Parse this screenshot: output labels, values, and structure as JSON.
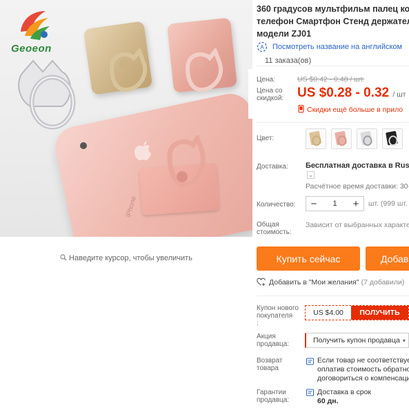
{
  "colors": {
    "accent": "#e62e04",
    "button": "#fb7a1a",
    "link": "#2a64c5"
  },
  "brand": {
    "logo_text": "Geoeon"
  },
  "gallery": {
    "phone_text": "iPhone",
    "zoom_hint": "Наведите курсор, чтобы увеличить"
  },
  "product": {
    "title_lines": [
      "360 градусов мультфильм палец коль",
      "телефон Смартфон Стенд держатель",
      "модели ZJ01"
    ],
    "translate_link": "Посмотреть название на английском",
    "orders": "11 заказа(ов)"
  },
  "price": {
    "label": "Цена:",
    "old": "US $0.42 - 0.48 / шт.",
    "discount_label_1": "Цена со",
    "discount_label_2": "скидкой:",
    "new": "US $0.28 - 0.32",
    "unit": "/ шт",
    "discount_note": "Скидки ещё больше в прило"
  },
  "options": {
    "color_label": "Цвет:",
    "color_swatches": [
      "gold",
      "rose-gold",
      "silver",
      "black"
    ],
    "shipping_label": "Доставка:",
    "shipping_value": "Бесплатная доставка в Russia",
    "shipping_time": "Расчётное время доставки: 30-",
    "quantity_label": "Количество:",
    "quantity_minus": "−",
    "quantity_value": "1",
    "quantity_plus": "+",
    "quantity_note": "шт. (999 шт.",
    "total_label_1": "Общая",
    "total_label_2": "стоимость:",
    "total_note": "Зависит от выбранных характе"
  },
  "actions": {
    "buy_now": "Купить сейчас",
    "add_to_cart": "Добав",
    "wishlist": "Добавить в \"Мои желания\"",
    "wishlist_count": "(7 добавили)"
  },
  "coupons": {
    "new_user_label_1": "Купон нового",
    "new_user_label_2": "покупателя",
    "new_user_label_3": ":",
    "coupon_value": "US $4.00",
    "coupon_button": "ПОЛУЧИТЬ",
    "seller_promo_label_1": "Акция",
    "seller_promo_label_2": "продавца:",
    "seller_promo_select": "Получить купон продавца",
    "return_label_1": "Возврат",
    "return_label_2": "товара",
    "return_text": [
      "Если товар не соответствует",
      "оплатив стоимость обратно",
      "договориться о компенсаци"
    ],
    "guarantee_label_1": "Гарантии",
    "guarantee_label_2": "продавца:",
    "guarantee_text": [
      "Доставка в срок",
      "60 дн."
    ]
  }
}
